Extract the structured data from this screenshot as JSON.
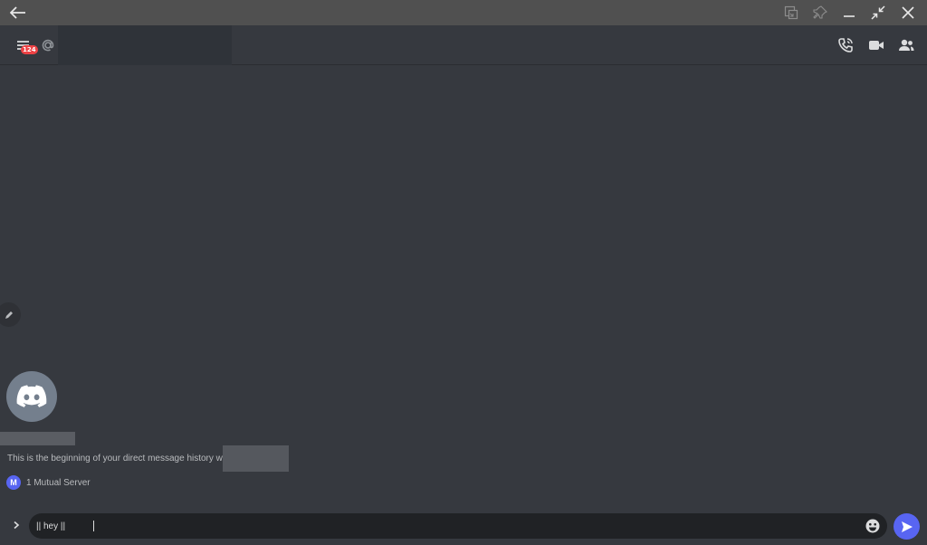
{
  "header": {
    "unread_badge": "124"
  },
  "chat": {
    "intro_text": "This is the beginning of your direct message history with @",
    "mutual_server_initial": "M",
    "mutual_server_label": "1 Mutual Server"
  },
  "composer": {
    "value": "|| hey ||"
  },
  "colors": {
    "background": "#36393f",
    "title_bar": "#505050",
    "composer": "#202225",
    "accent": "#5865f2",
    "badge": "#ed4245"
  },
  "icons": {
    "title_bar": [
      "back-arrow-icon",
      "compact-mode-icon",
      "pin-icon",
      "minimize-icon",
      "restore-icon",
      "close-icon"
    ],
    "header": [
      "menu-icon",
      "at-sign-icon",
      "call-icon",
      "video-icon",
      "members-icon"
    ],
    "chat": [
      "pencil-icon",
      "discord-logo-icon"
    ],
    "composer": [
      "chevron-right-icon",
      "emoji-icon",
      "send-icon"
    ]
  }
}
